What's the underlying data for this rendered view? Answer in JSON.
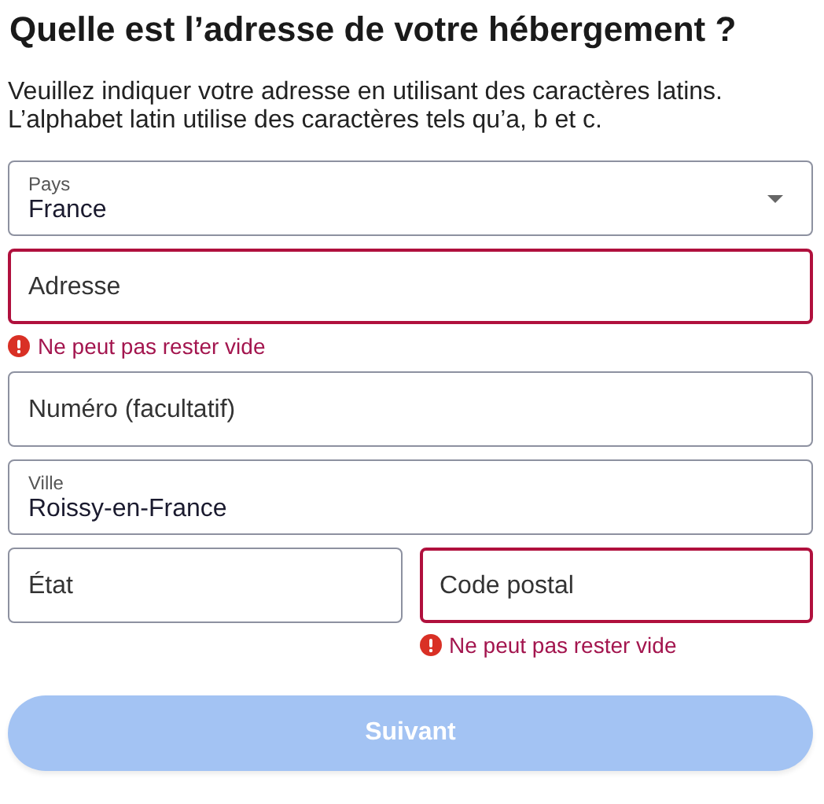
{
  "title": "Quelle est l’adresse de votre hébergement ?",
  "intro": [
    "Veuillez indiquer votre adresse en utilisant des caractères latins.",
    "L’alphabet latin utilise des caractères tels qu’a, b et c."
  ],
  "rows": [
    {
      "fields": [
        {
          "kind": "select",
          "label": "Pays",
          "value": "France",
          "invalid": false
        }
      ]
    },
    {
      "fields": [
        {
          "kind": "text",
          "label": "Adresse",
          "invalid": true,
          "error": "Ne peut pas rester vide"
        }
      ]
    },
    {
      "fields": [
        {
          "kind": "text",
          "label": "Numéro (facultatif)",
          "invalid": false
        }
      ]
    },
    {
      "fields": [
        {
          "kind": "text",
          "label": "Ville",
          "value": "Roissy-en-France",
          "invalid": false
        }
      ]
    },
    {
      "fields": [
        {
          "kind": "text",
          "label": "État",
          "invalid": false
        },
        {
          "kind": "text",
          "label": "Code postal",
          "invalid": true,
          "error": "Ne peut pas rester vide"
        }
      ]
    }
  ],
  "button": {
    "label": "Suivant",
    "disabled": true
  }
}
